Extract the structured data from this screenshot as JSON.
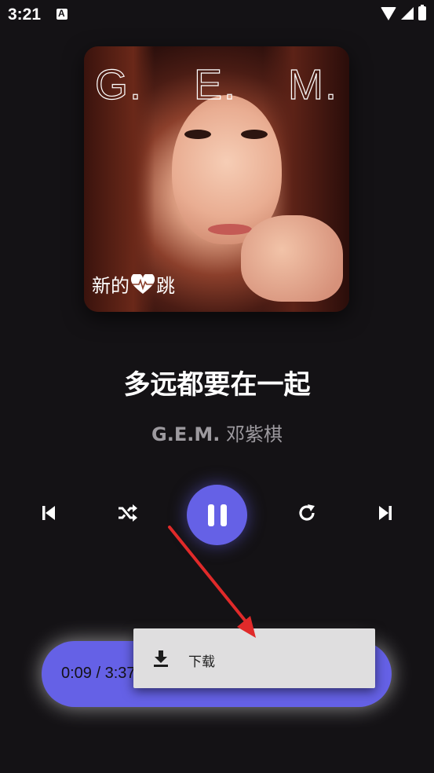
{
  "status_bar": {
    "time": "3:21"
  },
  "album": {
    "logo_letters": [
      "G.",
      "E.",
      "M."
    ],
    "subtitle_left": "新的",
    "subtitle_right": "跳"
  },
  "track": {
    "title": "多远都要在一起",
    "artist_en": "G.E.M.",
    "artist_zh": "邓紫棋"
  },
  "playback": {
    "position_text": "0:09 / 3:37",
    "state": "playing"
  },
  "context_menu": {
    "items": [
      {
        "icon": "download-icon",
        "label": "下载"
      }
    ]
  },
  "colors": {
    "background": "#141215",
    "accent": "#6561e6",
    "annotation_arrow": "#e02a2a",
    "menu_bg": "#dfdedf"
  }
}
